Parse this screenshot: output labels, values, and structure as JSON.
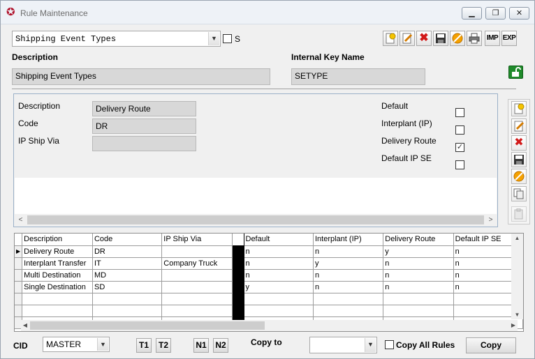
{
  "window": {
    "title": "Rule Maintenance",
    "minimize": "▁",
    "restore": "❐",
    "close": "✕"
  },
  "header": {
    "rule_select": "Shipping Event Types",
    "s_label": "S",
    "description_label": "Description",
    "description_value": "Shipping Event Types",
    "internal_key_label": "Internal Key Name",
    "internal_key_value": "SETYPE"
  },
  "toolbar": {
    "new": "new-icon",
    "edit": "edit-icon",
    "delete": "delete-icon",
    "save": "save-icon",
    "cancel": "cancel-icon",
    "print": "print-icon",
    "imp_label": "IMP",
    "exp_label": "EXP"
  },
  "detail": {
    "description_label": "Description",
    "description_value": "Delivery Route",
    "code_label": "Code",
    "code_value": "DR",
    "ip_ship_via_label": "IP Ship Via",
    "ip_ship_via_value": "",
    "default_label": "Default",
    "interplant_label": "Interplant (IP)",
    "delivery_route_label": "Delivery Route",
    "default_ip_se_label": "Default IP SE",
    "default_checked": false,
    "interplant_checked": false,
    "delivery_route_checked": true,
    "default_ip_se_checked": false
  },
  "grid": {
    "columns": [
      "Description",
      "Code",
      "IP Ship Via",
      "",
      "Default",
      "Interplant (IP)",
      "Delivery Route",
      "Default IP SE"
    ],
    "rows": [
      [
        "Delivery Route",
        "DR",
        "",
        "",
        "n",
        "n",
        "y",
        "n"
      ],
      [
        "Interplant Transfer",
        "IT",
        "Company Truck",
        "",
        "n",
        "y",
        "n",
        "n"
      ],
      [
        "Multi Destination",
        "MD",
        "",
        "",
        "n",
        "n",
        "n",
        "n"
      ],
      [
        "Single Destination",
        "SD",
        "",
        "",
        "y",
        "n",
        "n",
        "n"
      ]
    ]
  },
  "footer": {
    "cid_label": "CID",
    "cid_value": "MASTER",
    "t1": "T1",
    "t2": "T2",
    "n1": "N1",
    "n2": "N2",
    "copy_to_label": "Copy to",
    "copy_to_value": "",
    "copy_all_rules_label": "Copy All Rules",
    "copy_button": "Copy"
  }
}
